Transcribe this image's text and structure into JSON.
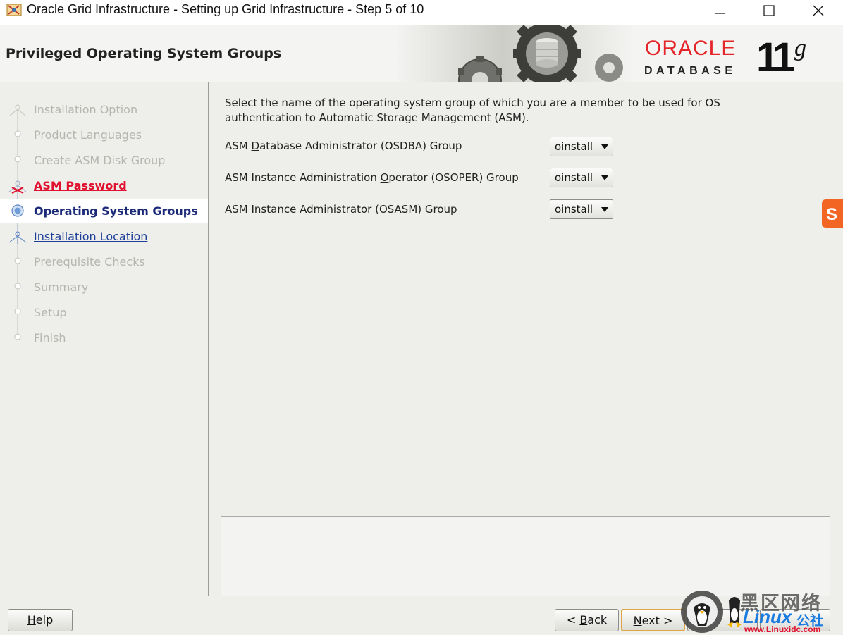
{
  "window": {
    "title": "Oracle Grid Infrastructure - Setting up Grid Infrastructure - Step 5 of 10"
  },
  "header": {
    "title": "Privileged Operating System Groups",
    "brand": "ORACLE",
    "product": "DATABASE",
    "version_major": "11",
    "version_suffix": "g"
  },
  "steps": [
    {
      "label": "Installation Option",
      "state": "done"
    },
    {
      "label": "Product Languages",
      "state": "done"
    },
    {
      "label": "Create ASM Disk Group",
      "state": "done"
    },
    {
      "label": "ASM Password",
      "state": "error"
    },
    {
      "label": "Operating System Groups",
      "state": "current"
    },
    {
      "label": "Installation Location",
      "state": "link"
    },
    {
      "label": "Prerequisite Checks",
      "state": "pending"
    },
    {
      "label": "Summary",
      "state": "pending"
    },
    {
      "label": "Setup",
      "state": "pending"
    },
    {
      "label": "Finish",
      "state": "pending"
    }
  ],
  "main": {
    "instructions": "Select the name of the operating system group of which you are a member to be used for OS authentication to Automatic Storage Management (ASM).",
    "groups": [
      {
        "label_pre": "ASM ",
        "mnemonic": "D",
        "label_post": "atabase Administrator (OSDBA) Group",
        "value": "oinstall"
      },
      {
        "label_pre": "ASM Instance Administration ",
        "mnemonic": "O",
        "label_post": "perator (OSOPER) Group",
        "value": "oinstall"
      },
      {
        "label_pre": "",
        "mnemonic": "A",
        "label_post": "SM Instance Administrator (OSASM) Group",
        "value": "oinstall"
      }
    ]
  },
  "buttons": {
    "help_mn": "H",
    "help_rest": "elp",
    "back_pre": "< ",
    "back_mn": "B",
    "back_rest": "ack",
    "next_mn": "N",
    "next_rest": "ext >"
  },
  "watermark": {
    "text1": "黑区网络",
    "text2": "Linux",
    "text3": "公社",
    "url": "www.Linuxidc.com"
  },
  "colors": {
    "oracle_red": "#e4262a",
    "error_red": "#e0102e",
    "link_blue": "#1e3f9a",
    "current_blue": "#1a2a78"
  }
}
